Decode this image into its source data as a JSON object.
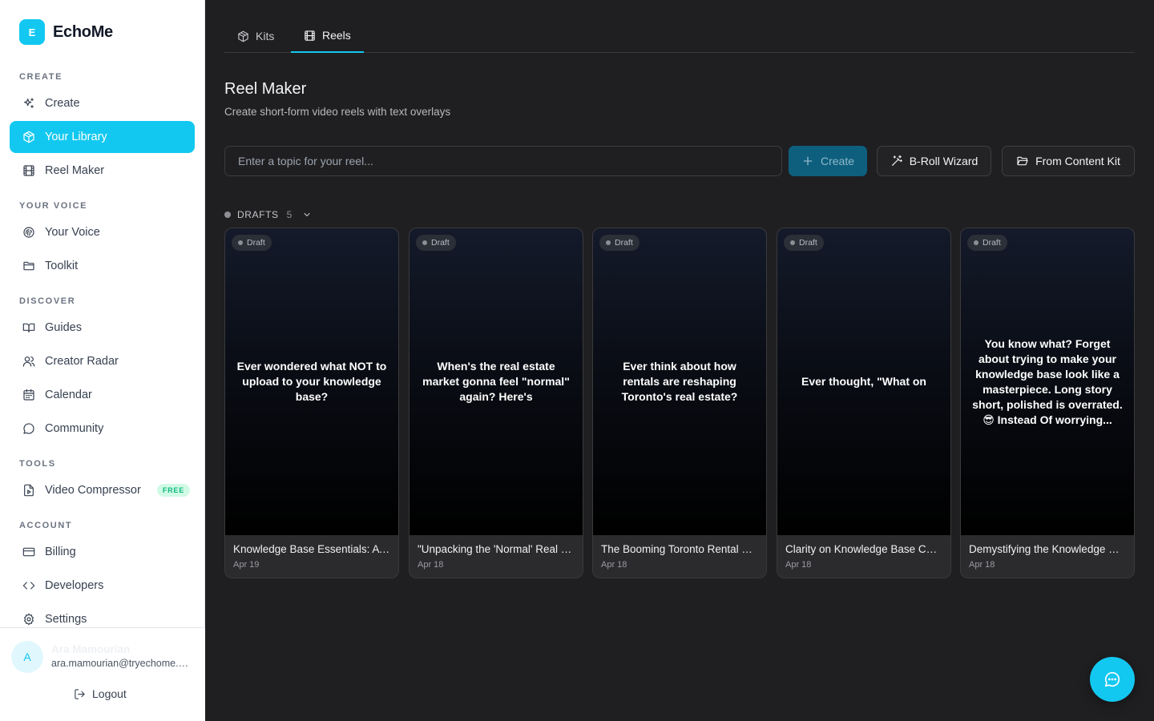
{
  "brand": {
    "logo_letter": "E",
    "name": "EchoMe"
  },
  "sidebar": {
    "sections": [
      {
        "label": "CREATE"
      },
      {
        "label": "YOUR VOICE"
      },
      {
        "label": "DISCOVER"
      },
      {
        "label": "TOOLS"
      },
      {
        "label": "ACCOUNT"
      }
    ],
    "items": [
      {
        "label": "Create",
        "icon": "sparkles-icon"
      },
      {
        "label": "Your Library",
        "icon": "box-icon",
        "active": true
      },
      {
        "label": "Reel Maker",
        "icon": "film-icon"
      },
      {
        "label": "Your Voice",
        "icon": "fingerprint-icon"
      },
      {
        "label": "Toolkit",
        "icon": "folder-icon"
      },
      {
        "label": "Guides",
        "icon": "book-icon"
      },
      {
        "label": "Creator Radar",
        "icon": "users-icon"
      },
      {
        "label": "Calendar",
        "icon": "calendar-icon"
      },
      {
        "label": "Community",
        "icon": "chat-bubble-icon"
      },
      {
        "label": "Video Compressor",
        "icon": "file-video-icon",
        "badge": "FREE"
      },
      {
        "label": "Billing",
        "icon": "credit-card-icon"
      },
      {
        "label": "Developers",
        "icon": "code-icon"
      },
      {
        "label": "Settings",
        "icon": "gear-icon"
      }
    ],
    "user": {
      "avatar_letter": "A",
      "name": "Ara Mamourian",
      "email": "ara.mamourian@tryechome.com"
    },
    "logout_label": "Logout"
  },
  "tabs": [
    {
      "label": "Kits",
      "icon": "box-icon"
    },
    {
      "label": "Reels",
      "icon": "film-icon",
      "active": true
    }
  ],
  "page": {
    "title": "Reel Maker",
    "subtitle": "Create short-form video reels with text overlays"
  },
  "toolbar": {
    "topic_placeholder": "Enter a topic for your reel...",
    "topic_value": "",
    "create_label": "Create",
    "broll_label": "B-Roll Wizard",
    "kit_label": "From Content Kit"
  },
  "drafts": {
    "label": "DRAFTS",
    "count": "5",
    "items": [
      {
        "badge": "Draft",
        "overlay": "Ever wondered what NOT to upload to your knowledge base?",
        "title": "Knowledge Base Essentials: A Guide",
        "date": "Apr 19"
      },
      {
        "badge": "Draft",
        "overlay": "When's the real estate market gonna feel \"normal\" again? Here's",
        "title": "\"Unpacking the 'Normal' Real Estate Market\"",
        "date": "Apr 18"
      },
      {
        "badge": "Draft",
        "overlay": "Ever think about how rentals are reshaping Toronto's real estate?",
        "title": "The Booming Toronto Rental Market",
        "date": "Apr 18"
      },
      {
        "badge": "Draft",
        "overlay": "Ever thought, \"What on",
        "title": "Clarity on Knowledge Base Content",
        "date": "Apr 18"
      },
      {
        "badge": "Draft",
        "overlay": "You know what? Forget about trying to make your knowledge base look like a masterpiece. Long story short, polished is overrated. 😎 Instead Of worrying...",
        "title": "Demystifying the Knowledge Base",
        "date": "Apr 18"
      }
    ]
  },
  "colors": {
    "accent": "#13c8f0",
    "main_bg": "#1f1f21",
    "sidebar_bg": "#ffffff",
    "create_button_bg": "#0e5f7e",
    "free_badge_bg": "#d1fae5",
    "free_badge_text": "#10b981"
  }
}
